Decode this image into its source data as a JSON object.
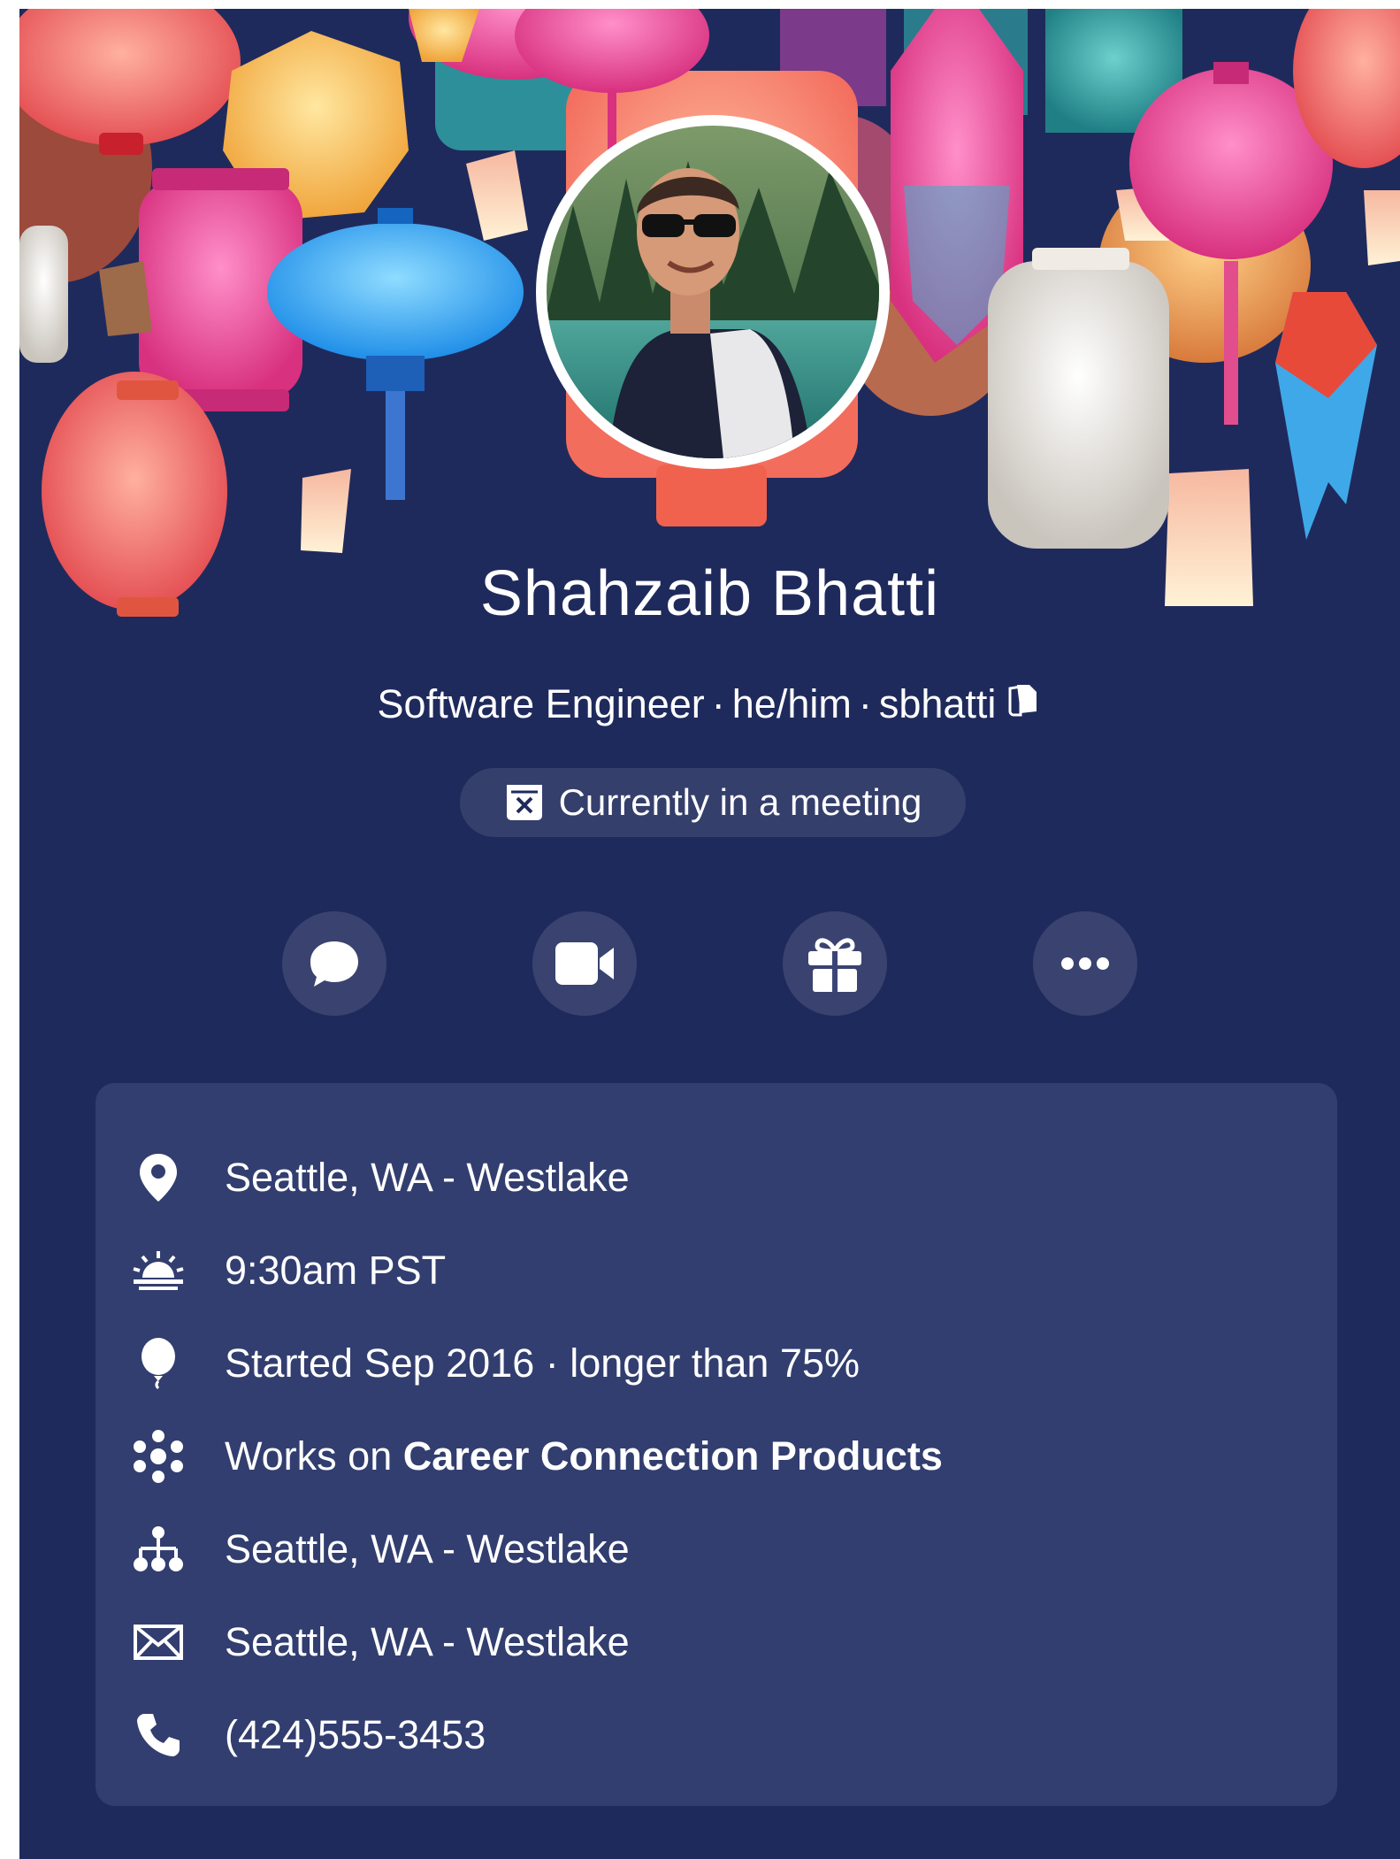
{
  "profile": {
    "name": "Shahzaib Bhatti",
    "title": "Software Engineer",
    "pronouns": "he/him",
    "username": "sbhatti",
    "separator": "·",
    "status": "Currently in a meeting"
  },
  "actions": [
    {
      "name": "message-button",
      "icon": "chat-bubble-icon"
    },
    {
      "name": "video-call-button",
      "icon": "video-camera-icon"
    },
    {
      "name": "gift-button",
      "icon": "gift-icon"
    },
    {
      "name": "more-button",
      "icon": "more-dots-icon"
    }
  ],
  "info": {
    "location": "Seattle, WA - Westlake",
    "local_time": "9:30am PST",
    "tenure": "Started Sep 2016 · longer than 75%",
    "works_on_prefix": "Works on ",
    "works_on_team": "Career Connection Products",
    "org": "Seattle, WA - Westlake",
    "mail": "Seattle, WA - Westlake",
    "phone": "(424)555-3453"
  },
  "colors": {
    "background": "#1f2a5c",
    "info_box": "#323e6f",
    "text": "#ffffff"
  }
}
